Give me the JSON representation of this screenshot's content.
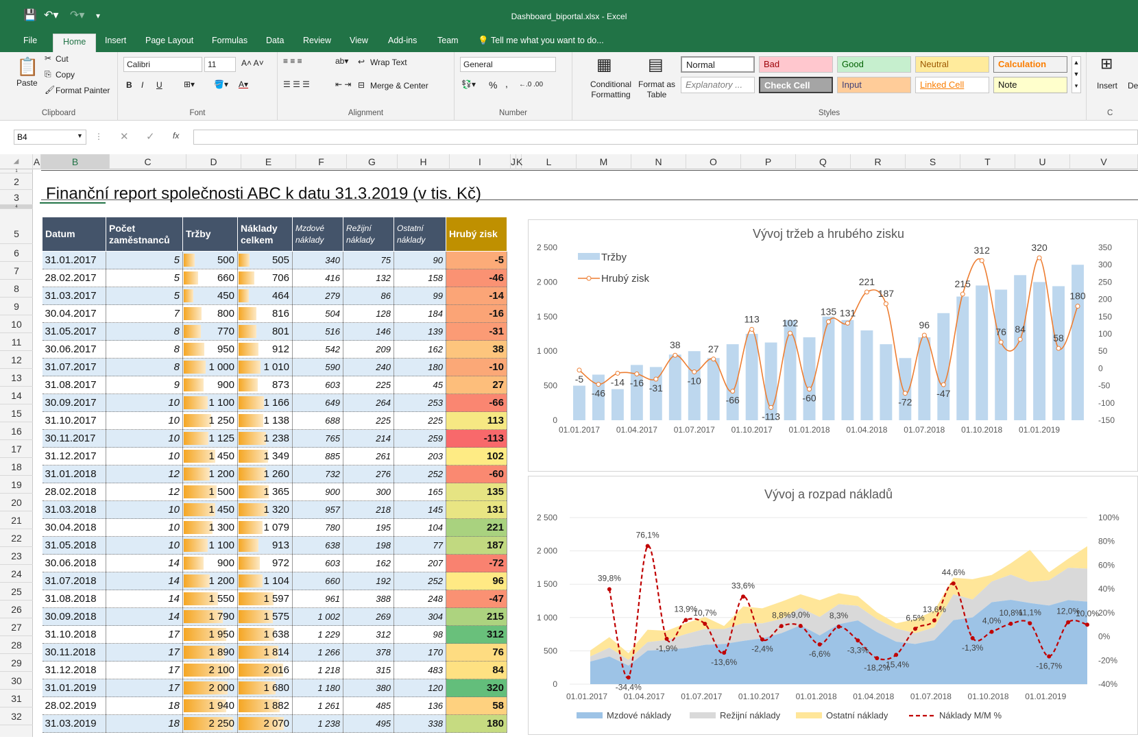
{
  "window": {
    "title": "Dashboard_biportal.xlsx - Excel"
  },
  "ribbon_tabs": [
    "File",
    "Home",
    "Insert",
    "Page Layout",
    "Formulas",
    "Data",
    "Review",
    "View",
    "Add-ins",
    "Team"
  ],
  "tell_me": "Tell me what you want to do...",
  "clipboard": {
    "paste": "Paste",
    "cut": "Cut",
    "copy": "Copy",
    "format_painter": "Format Painter",
    "label": "Clipboard"
  },
  "font": {
    "name": "Calibri",
    "size": "11",
    "bold": "B",
    "italic": "I",
    "underline": "U",
    "label": "Font"
  },
  "alignment": {
    "wrap": "Wrap Text",
    "merge": "Merge & Center",
    "label": "Alignment"
  },
  "number": {
    "format": "General",
    "percent": "%",
    "comma": ",",
    "label": "Number"
  },
  "styles": {
    "cond": "Conditional Formatting",
    "fmt_table": "Format as Table",
    "normal": "Normal",
    "bad": "Bad",
    "good": "Good",
    "neutral": "Neutral",
    "calculation": "Calculation",
    "explanatory": "Explanatory ...",
    "check_cell": "Check Cell",
    "input": "Input",
    "linked_cell": "Linked Cell",
    "note": "Note",
    "label": "Styles"
  },
  "cells": {
    "insert": "Insert",
    "delete": "De",
    "label": "C"
  },
  "formula_bar": {
    "name_box": "B4",
    "fx": "fx",
    "value": ""
  },
  "columns": [
    "A",
    "B",
    "C",
    "D",
    "E",
    "F",
    "G",
    "H",
    "I",
    "J",
    "K",
    "L",
    "M",
    "N",
    "O",
    "P",
    "Q",
    "R",
    "S",
    "T",
    "U",
    "V"
  ],
  "rows": [
    "1",
    "2",
    "3",
    "4",
    "5",
    "6",
    "7",
    "8",
    "9",
    "10",
    "11",
    "12",
    "13",
    "14",
    "15",
    "16",
    "17",
    "18",
    "19",
    "20",
    "21",
    "22",
    "23",
    "24",
    "25",
    "26",
    "27",
    "28",
    "29",
    "30",
    "31",
    "32"
  ],
  "report_title": "Finanční report společnosti ABC k datu 31.3.2019 (v tis. Kč)",
  "table": {
    "headers": [
      "Datum",
      "Počet zaměstnanců",
      "Tržby",
      "Náklady celkem",
      "Mzdové náklady",
      "Režijní náklady",
      "Ostatní náklady",
      "Hrubý zisk"
    ],
    "rows": [
      [
        "31.01.2017",
        "5",
        "500",
        "505",
        "340",
        "75",
        "90",
        "-5"
      ],
      [
        "28.02.2017",
        "5",
        "660",
        "706",
        "416",
        "132",
        "158",
        "-46"
      ],
      [
        "31.03.2017",
        "5",
        "450",
        "464",
        "279",
        "86",
        "99",
        "-14"
      ],
      [
        "30.04.2017",
        "7",
        "800",
        "816",
        "504",
        "128",
        "184",
        "-16"
      ],
      [
        "31.05.2017",
        "8",
        "770",
        "801",
        "516",
        "146",
        "139",
        "-31"
      ],
      [
        "30.06.2017",
        "8",
        "950",
        "912",
        "542",
        "209",
        "162",
        "38"
      ],
      [
        "31.07.2017",
        "8",
        "1 000",
        "1 010",
        "590",
        "240",
        "180",
        "-10"
      ],
      [
        "31.08.2017",
        "9",
        "900",
        "873",
        "603",
        "225",
        "45",
        "27"
      ],
      [
        "30.09.2017",
        "10",
        "1 100",
        "1 166",
        "649",
        "264",
        "253",
        "-66"
      ],
      [
        "31.10.2017",
        "10",
        "1 250",
        "1 138",
        "688",
        "225",
        "225",
        "113"
      ],
      [
        "30.11.2017",
        "10",
        "1 125",
        "1 238",
        "765",
        "214",
        "259",
        "-113"
      ],
      [
        "31.12.2017",
        "10",
        "1 450",
        "1 349",
        "885",
        "261",
        "203",
        "102"
      ],
      [
        "31.01.2018",
        "12",
        "1 200",
        "1 260",
        "732",
        "276",
        "252",
        "-60"
      ],
      [
        "28.02.2018",
        "12",
        "1 500",
        "1 365",
        "900",
        "300",
        "165",
        "135"
      ],
      [
        "31.03.2018",
        "10",
        "1 450",
        "1 320",
        "957",
        "218",
        "145",
        "131"
      ],
      [
        "30.04.2018",
        "10",
        "1 300",
        "1 079",
        "780",
        "195",
        "104",
        "221"
      ],
      [
        "31.05.2018",
        "10",
        "1 100",
        "913",
        "638",
        "198",
        "77",
        "187"
      ],
      [
        "30.06.2018",
        "14",
        "900",
        "972",
        "603",
        "162",
        "207",
        "-72"
      ],
      [
        "31.07.2018",
        "14",
        "1 200",
        "1 104",
        "660",
        "192",
        "252",
        "96"
      ],
      [
        "31.08.2018",
        "14",
        "1 550",
        "1 597",
        "961",
        "388",
        "248",
        "-47"
      ],
      [
        "30.09.2018",
        "14",
        "1 790",
        "1 575",
        "1 002",
        "269",
        "304",
        "215"
      ],
      [
        "31.10.2018",
        "17",
        "1 950",
        "1 638",
        "1 229",
        "312",
        "98",
        "312"
      ],
      [
        "30.11.2018",
        "17",
        "1 890",
        "1 814",
        "1 266",
        "378",
        "170",
        "76"
      ],
      [
        "31.12.2018",
        "17",
        "2 100",
        "2 016",
        "1 218",
        "315",
        "483",
        "84"
      ],
      [
        "31.01.2019",
        "17",
        "2 000",
        "1 680",
        "1 180",
        "380",
        "120",
        "320"
      ],
      [
        "28.02.2019",
        "18",
        "1 940",
        "1 882",
        "1 261",
        "485",
        "136",
        "58"
      ],
      [
        "31.03.2019",
        "18",
        "2 250",
        "2 070",
        "1 238",
        "495",
        "338",
        "180"
      ]
    ]
  },
  "chart_data": [
    {
      "type": "bar",
      "title": "Vývoj tržeb a hrubého zisku",
      "x_ticks": [
        "01.01.2017",
        "01.04.2017",
        "01.07.2017",
        "01.10.2017",
        "01.01.2018",
        "01.04.2018",
        "01.07.2018",
        "01.10.2018",
        "01.01.2019"
      ],
      "y_ticks": [
        "0",
        "500",
        "1 000",
        "1 500",
        "2 000",
        "2 500"
      ],
      "y2_ticks": [
        "-150",
        "-100",
        "-50",
        "0",
        "50",
        "100",
        "150",
        "200",
        "250",
        "300",
        "350"
      ],
      "ylim": [
        0,
        2500
      ],
      "y2lim": [
        -150,
        350
      ],
      "legend": "top-left",
      "series": [
        {
          "name": "Tržby",
          "kind": "bar",
          "color": "#bdd7ee",
          "values": [
            500,
            660,
            450,
            800,
            770,
            950,
            1000,
            900,
            1100,
            1250,
            1125,
            1450,
            1200,
            1500,
            1450,
            1300,
            1100,
            900,
            1200,
            1550,
            1790,
            1950,
            1890,
            2100,
            2000,
            1940,
            2250
          ]
        },
        {
          "name": "Hrubý zisk",
          "kind": "line",
          "color": "#ed7d31",
          "values": [
            -5,
            -46,
            -14,
            -16,
            -31,
            38,
            -10,
            27,
            -66,
            113,
            -113,
            102,
            -60,
            135,
            131,
            221,
            187,
            -72,
            96,
            -47,
            215,
            312,
            76,
            84,
            320,
            58,
            180
          ]
        }
      ]
    },
    {
      "type": "area",
      "title": "Vývoj a rozpad nákladů",
      "x_ticks": [
        "01.01.2017",
        "01.04.2017",
        "01.07.2017",
        "01.10.2017",
        "01.01.2018",
        "01.04.2018",
        "01.07.2018",
        "01.10.2018",
        "01.01.2019"
      ],
      "y_ticks": [
        "0",
        "500",
        "1 000",
        "1 500",
        "2 000",
        "2 500"
      ],
      "y2_ticks": [
        "-40%",
        "-20%",
        "0%",
        "20%",
        "40%",
        "60%",
        "80%",
        "100%"
      ],
      "ylim": [
        0,
        2500
      ],
      "y2lim": [
        -40,
        100
      ],
      "legend": "bottom",
      "series": [
        {
          "name": "Mzdové náklady",
          "kind": "area",
          "color": "#9dc3e6",
          "values": [
            340,
            416,
            279,
            504,
            516,
            542,
            590,
            603,
            649,
            688,
            765,
            885,
            732,
            900,
            957,
            780,
            638,
            603,
            660,
            961,
            1002,
            1229,
            1266,
            1218,
            1180,
            1261,
            1238
          ]
        },
        {
          "name": "Režijní náklady",
          "kind": "area",
          "color": "#d9d9d9",
          "values": [
            75,
            132,
            86,
            128,
            146,
            209,
            240,
            225,
            264,
            225,
            214,
            261,
            276,
            300,
            218,
            195,
            198,
            162,
            192,
            388,
            269,
            312,
            378,
            315,
            380,
            485,
            495
          ]
        },
        {
          "name": "Ostatní náklady",
          "kind": "area",
          "color": "#ffe699",
          "values": [
            90,
            158,
            99,
            184,
            139,
            162,
            180,
            45,
            253,
            225,
            259,
            203,
            252,
            165,
            145,
            104,
            77,
            207,
            252,
            248,
            304,
            98,
            170,
            483,
            120,
            136,
            338
          ]
        },
        {
          "name": "Náklady M/M %",
          "kind": "line",
          "color": "#c00000",
          "values": [
            null,
            39.8,
            -34.4,
            76.1,
            -1.9,
            13.9,
            10.7,
            -13.6,
            33.6,
            -2.4,
            8.8,
            9.0,
            -6.6,
            8.3,
            -3.3,
            -18.2,
            -15.4,
            6.5,
            13.6,
            44.6,
            -1.3,
            4.0,
            10.8,
            11.1,
            -16.7,
            12.0,
            10.0
          ],
          "labels": [
            "",
            "39,8%",
            "-34,4%",
            "76,1%",
            "-1,9%",
            "13,9%",
            "10,7%",
            "-13,6%",
            "33,6%",
            "-2,4%",
            "8,8%",
            "9,0%",
            "-6,6%",
            "8,3%",
            "-3,3%",
            "-18,2%",
            "-15,4%",
            "6,5%",
            "13,6%",
            "44,6%",
            "-1,3%",
            "4,0%",
            "10,8%",
            "11,1%",
            "-16,7%",
            "12,0%",
            "10,0%"
          ]
        }
      ]
    }
  ]
}
